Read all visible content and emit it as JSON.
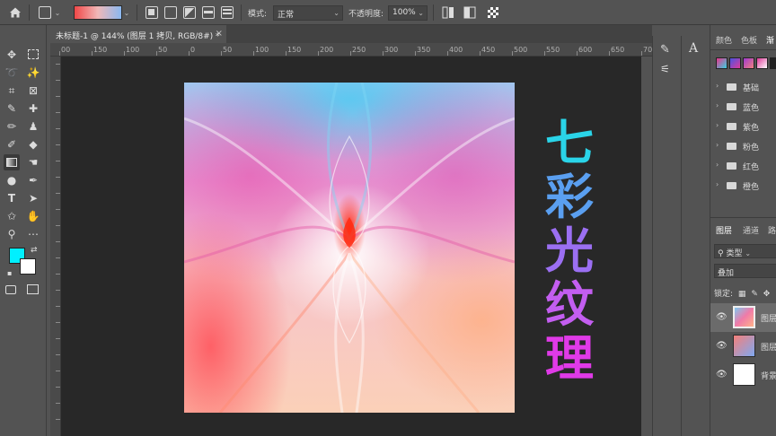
{
  "options_bar": {
    "mode_label": "模式:",
    "mode_value": "正常",
    "opacity_label": "不透明度:",
    "opacity_value": "100%"
  },
  "document_tab": {
    "title": "未标题-1 @ 144% (图层 1 拷贝, RGB/8#) *",
    "close_glyph": "×"
  },
  "ruler": {
    "top_ticks": [
      "00",
      "150",
      "100",
      "50",
      "0",
      "50",
      "100",
      "150",
      "200",
      "250",
      "300",
      "350",
      "400",
      "450",
      "500",
      "550",
      "600",
      "650",
      "70"
    ]
  },
  "artwork_title": {
    "chars": [
      "七",
      "彩",
      "光",
      "纹",
      "理"
    ],
    "colors": [
      "#2ad4e8",
      "#5a9ff0",
      "#9b6ff2",
      "#c35ef0",
      "#e03ae8"
    ]
  },
  "right_panel": {
    "tabs": [
      "颜色",
      "色板",
      "渐"
    ],
    "swatch_colors": [
      "#e8348c",
      "#4a52e0",
      "#a03ad0",
      "#e03a9a",
      "#222222"
    ],
    "folders": [
      "基础",
      "蓝色",
      "紫色",
      "粉色",
      "红色",
      "橙色"
    ],
    "layer_tabs": [
      "图层",
      "通道",
      "路"
    ],
    "filter_label": "类型",
    "blend_mode": "叠加",
    "lock_label": "锁定:",
    "layers": [
      {
        "name": "图层",
        "selected": true
      },
      {
        "name": "图层",
        "selected": false
      },
      {
        "name": "背景",
        "selected": false
      }
    ]
  },
  "colors": {
    "foreground": "#00f0ff",
    "background": "#ffffff"
  }
}
